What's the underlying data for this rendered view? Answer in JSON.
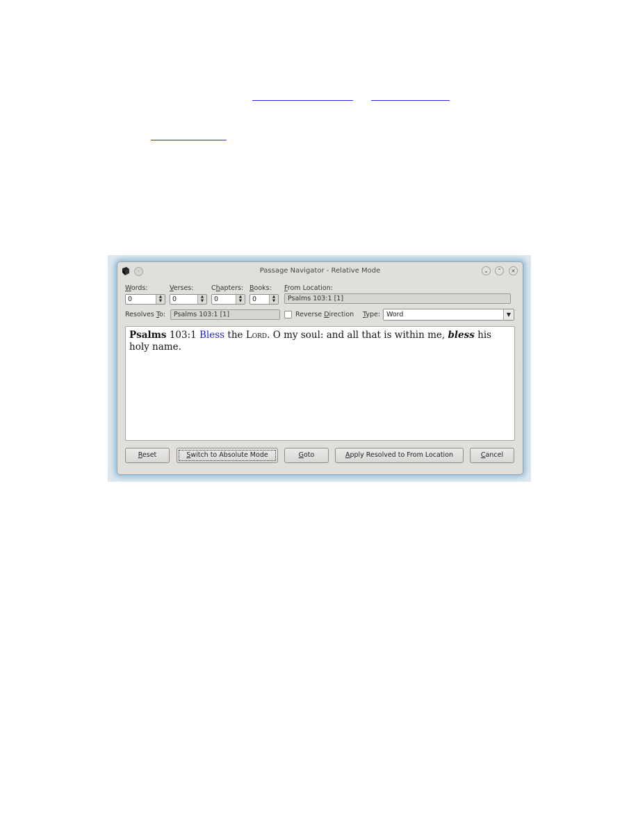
{
  "document": {
    "links": [
      "",
      "",
      ""
    ]
  },
  "window": {
    "title": "Passage Navigator - Relative Mode",
    "controls": {
      "menu": "·",
      "minimize": "⌄",
      "maximize": "⌃",
      "close": "×"
    }
  },
  "form": {
    "words": {
      "label_pre": "",
      "label_u": "W",
      "label_post": "ords:",
      "value": "0"
    },
    "verses": {
      "label_pre": "",
      "label_u": "V",
      "label_post": "erses:",
      "value": "0"
    },
    "chapters": {
      "label_pre": "C",
      "label_u": "h",
      "label_post": "apters:",
      "value": "0"
    },
    "books": {
      "label_pre": "",
      "label_u": "B",
      "label_post": "ooks:",
      "value": "0"
    },
    "from_location": {
      "label_pre": "",
      "label_u": "F",
      "label_post": "rom Location:",
      "value": "Psalms 103:1 [1]"
    },
    "resolves_to": {
      "label_pre": "Resolves ",
      "label_u": "T",
      "label_post": "o:",
      "value": "Psalms 103:1 [1]"
    },
    "reverse_direction": {
      "label_pre": "Reverse ",
      "label_u": "D",
      "label_post": "irection",
      "checked": false
    },
    "type": {
      "label_pre": "",
      "label_u": "T",
      "label_post": "ype:",
      "value": "Word"
    }
  },
  "passage": {
    "book": "Psalms",
    "chapter_verse": "103:1",
    "highlight_word": "Bless",
    "text_a": " the ",
    "lord": "Lord",
    "text_b": ". O my soul: and all that is within me, ",
    "emphasis": "bless",
    "text_c": " his holy name."
  },
  "buttons": {
    "reset": {
      "pre": "",
      "u": "R",
      "post": "eset"
    },
    "switch_mode": {
      "pre": "",
      "u": "S",
      "post": "witch to Absolute Mode"
    },
    "goto": {
      "pre": "",
      "u": "G",
      "post": "oto"
    },
    "apply": {
      "pre": "",
      "u": "A",
      "post": "pply Resolved to From Location"
    },
    "cancel": {
      "pre": "",
      "u": "C",
      "post": "ancel"
    }
  },
  "colors": {
    "link": "#2a2aee",
    "highlight": "#2020cc",
    "window_glow": "#6eaad7"
  }
}
